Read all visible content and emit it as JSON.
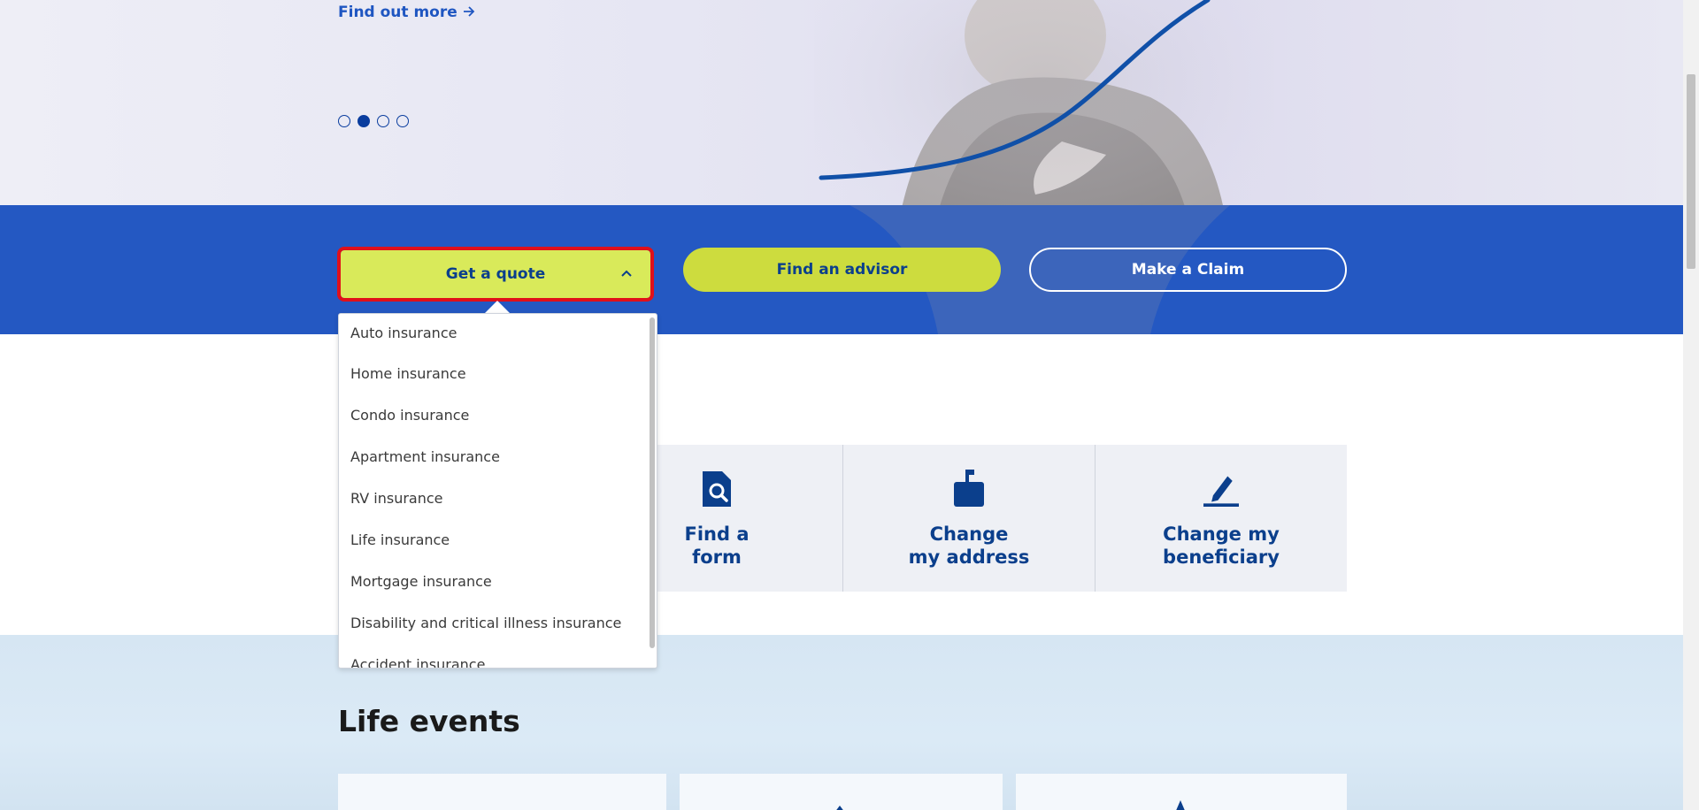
{
  "hero": {
    "find_more": "Find out more",
    "slides": [
      {
        "active": false
      },
      {
        "active": true
      },
      {
        "active": false
      },
      {
        "active": false
      }
    ]
  },
  "actions": {
    "quote_label": "Get a quote",
    "advisor_label": "Find an advisor",
    "claim_label": "Make a Claim"
  },
  "dropdown": {
    "items": [
      "Auto insurance",
      "Home insurance",
      "Condo insurance",
      "Apartment insurance",
      "RV insurance",
      "Life insurance",
      "Mortgage insurance",
      "Disability and critical illness insurance",
      "Accident insurance"
    ]
  },
  "tiles": [
    {
      "label": "Find a\nform",
      "icon": "document-search-icon"
    },
    {
      "label": "Change\nmy address",
      "icon": "mailbox-icon"
    },
    {
      "label": "Change my\nbeneficiary",
      "icon": "pencil-icon"
    }
  ],
  "life_events": {
    "title": "Life events"
  },
  "colors": {
    "primary_blue": "#2458c2",
    "dark_blue": "#0b3f8c",
    "lime": "#d9ea5a",
    "highlight_red": "#e0101a"
  }
}
